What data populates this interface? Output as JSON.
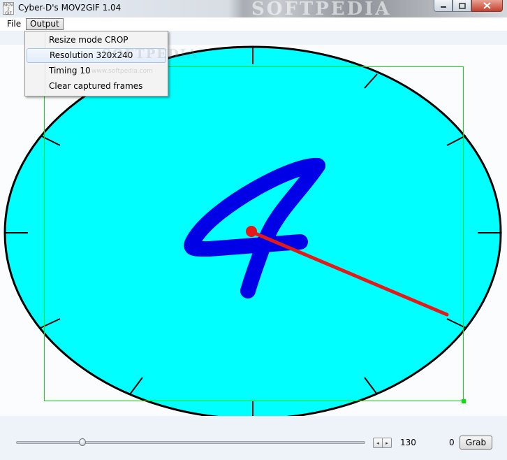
{
  "window": {
    "title": "Cyber-D's MOV2GIF 1.04",
    "icon_text": "MOV 2 GIF",
    "background_watermark": "SOFTPEDIA"
  },
  "menubar": {
    "items": [
      {
        "label": "File"
      },
      {
        "label": "Output"
      }
    ]
  },
  "dropdown": {
    "items": [
      {
        "label": "Resize mode CROP"
      },
      {
        "label": "Resolution 320x240"
      },
      {
        "label": "Timing 10"
      },
      {
        "label": "Clear captured frames"
      }
    ],
    "watermark": "SOFTPEDIA",
    "watermark_url": "www.softpedia.com"
  },
  "preview": {
    "clock_face_color": "#00ffff",
    "digit_color": "#0000e6",
    "hand_color": "#e61919",
    "crop_color": "#00e600",
    "digit": "4"
  },
  "controls": {
    "slider_fraction": 0.19,
    "frame_value": "130",
    "captured_count": "0",
    "grab_label": "Grab",
    "spin_left": "◂",
    "spin_right": "▸"
  }
}
